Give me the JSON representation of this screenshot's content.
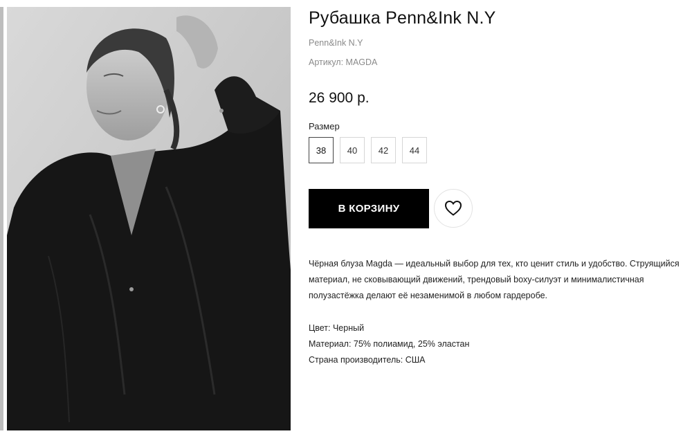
{
  "product": {
    "title": "Рубашка Penn&Ink N.Y",
    "brand": "Penn&Ink N.Y",
    "sku": "Артикул: MAGDA",
    "price": "26 900 р.",
    "size_label": "Размер",
    "sizes": [
      "38",
      "40",
      "42",
      "44"
    ],
    "selected_size": "38",
    "add_to_cart_label": "В КОРЗИНУ",
    "favorite_icon": "heart-icon",
    "description": "Чёрная блуза Magda — идеальный выбор для тех, кто ценит стиль и удобство. Струящийся материал, не сковывающий движений, трендовый boxy-силуэт и минималистичная полузастёжка делают её незаменимой в любом гардеробе.",
    "specs": {
      "color": "Цвет: Черный",
      "material": "Материал: 75% полиамид, 25% эластан",
      "country": "Страна производитель: США"
    }
  },
  "colors": {
    "button_bg": "#000000",
    "button_text": "#ffffff",
    "muted_text": "#8a8a8a"
  }
}
